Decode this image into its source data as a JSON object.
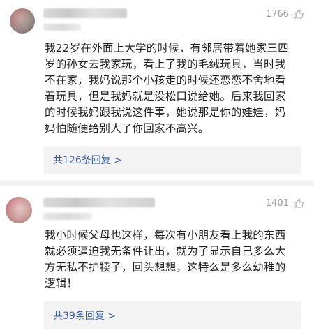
{
  "comments": [
    {
      "likes": "1766",
      "text": "我22岁在外面上大学的时候，有邻居带着她家三四\n岁的孙女去我家玩，看上了我的毛绒玩具，当时我\n不在家，我妈说那个小孩走的时候还恋恋不舍地看\n着玩具，但是我妈就是没松口说给她。后来我回家\n的时候我妈跟我说这件事，她说那是你的娃娃，妈\n妈怕随便给别人了你回家不高兴。",
      "replies_label": "共126条回复 >"
    },
    {
      "likes": "1401",
      "text": "我小时候父母也这样，每次有小朋友看上我的东西\n就必须逼迫我无条件让出，就为了显示自己多么大\n方无私不护犊子，回头想想，这特么是多么幼稚的\n逻辑！",
      "replies_label": "共39条回复 >"
    }
  ],
  "icons": {
    "like": "thumb-up-icon"
  },
  "colors": {
    "reply_link": "#3c5f9c",
    "meta": "#9a9a9a",
    "reply_bg": "#f3f3f3"
  }
}
